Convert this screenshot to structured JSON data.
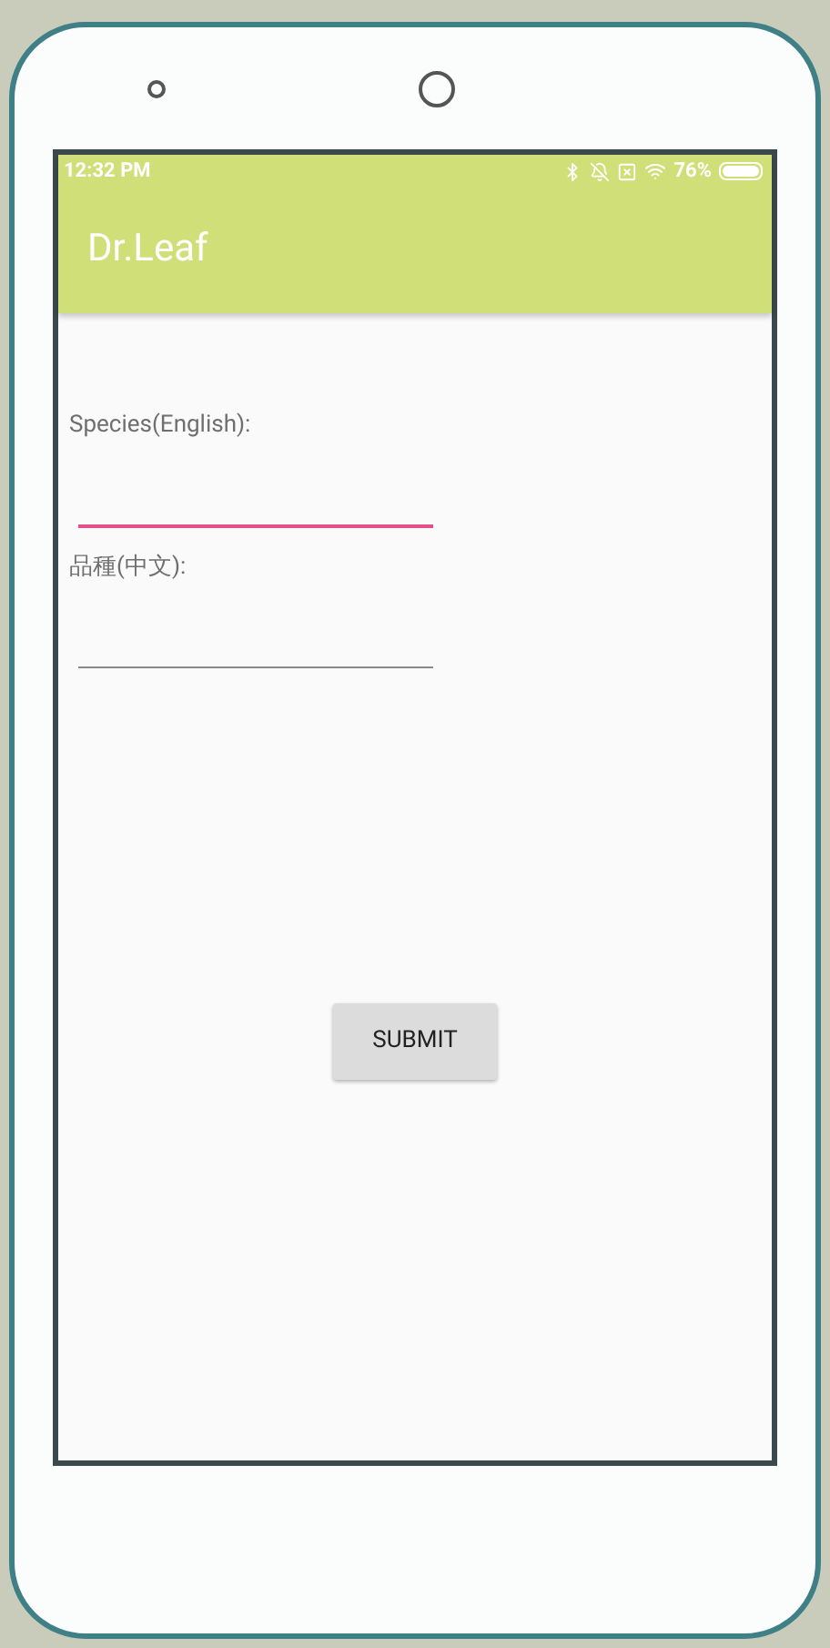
{
  "status_bar": {
    "time": "12:32 PM",
    "battery": "76%"
  },
  "app_bar": {
    "title": "Dr.Leaf"
  },
  "fields": [
    {
      "label": "Species(English):",
      "focused": true
    },
    {
      "label": "品種(中文):",
      "focused": false
    }
  ],
  "submit_button": {
    "label": "SUBMIT"
  }
}
